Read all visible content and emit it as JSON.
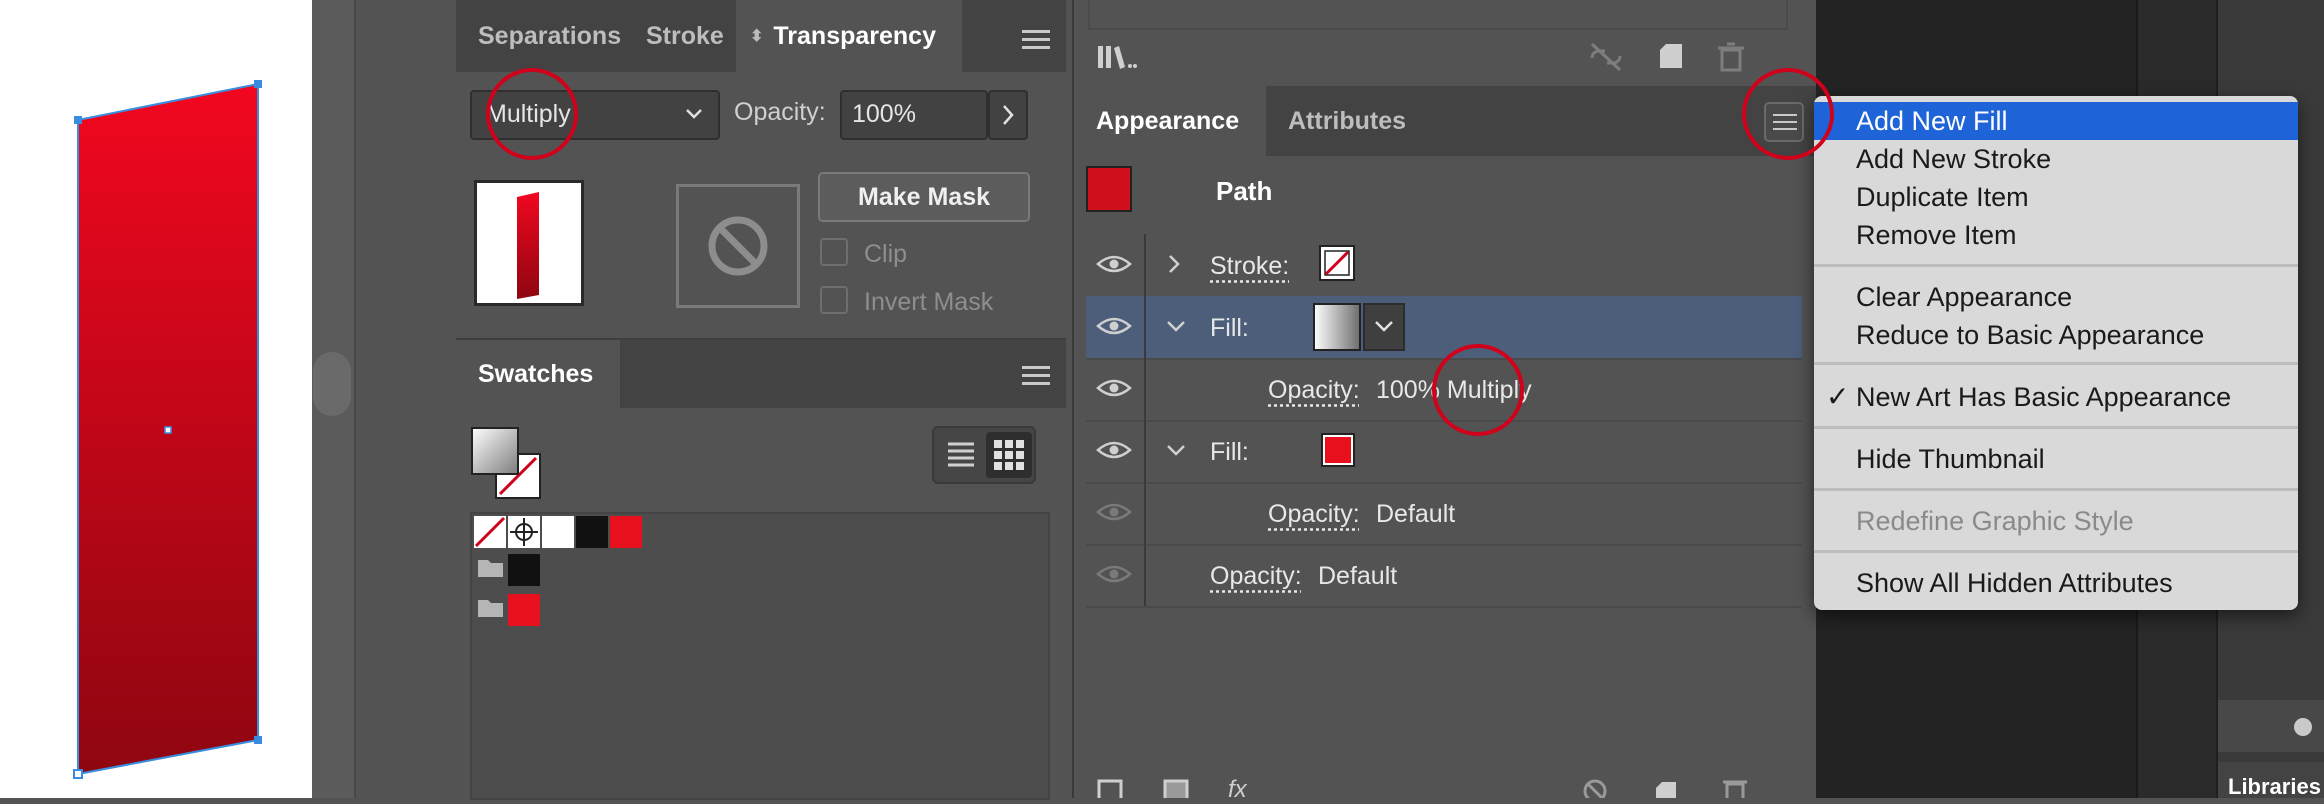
{
  "transparency_panel": {
    "tabs": [
      "Separations",
      "Stroke",
      "Transparency"
    ],
    "blend_mode": "Multiply",
    "opacity_label": "Opacity:",
    "opacity_value": "100%",
    "make_mask_label": "Make Mask",
    "clip_label": "Clip",
    "invert_mask_label": "Invert Mask"
  },
  "swatches_panel": {
    "tab": "Swatches"
  },
  "appearance_panel": {
    "tabs": [
      "Appearance",
      "Attributes"
    ],
    "object_label": "Path",
    "rows": [
      {
        "label": "Stroke:",
        "value": ""
      },
      {
        "label": "Fill:",
        "value": ""
      },
      {
        "label": "Opacity:",
        "value": "100% Multiply"
      },
      {
        "label": "Fill:",
        "value": ""
      },
      {
        "label": "Opacity:",
        "value": "Default"
      },
      {
        "label": "Opacity:",
        "value": "Default"
      }
    ]
  },
  "menu": {
    "items": [
      "Add New Fill",
      "Add New Stroke",
      "Duplicate Item",
      "Remove Item",
      "Clear Appearance",
      "Reduce to Basic Appearance",
      "New Art Has Basic Appearance",
      "Hide Thumbnail",
      "Redefine Graphic Style",
      "Show All Hidden Attributes"
    ],
    "checked_item": "New Art Has Basic Appearance",
    "highlighted_item": "Add New Fill",
    "disabled_item": "Redefine Graphic Style"
  },
  "libraries_tab": "Libraries",
  "colors": {
    "accent_red": "#d0021b",
    "fill_red": "#e8101c",
    "menu_highlight": "#1e63d8",
    "selection_blue": "#4c5e7a"
  },
  "icons": {
    "fx": "fx"
  }
}
